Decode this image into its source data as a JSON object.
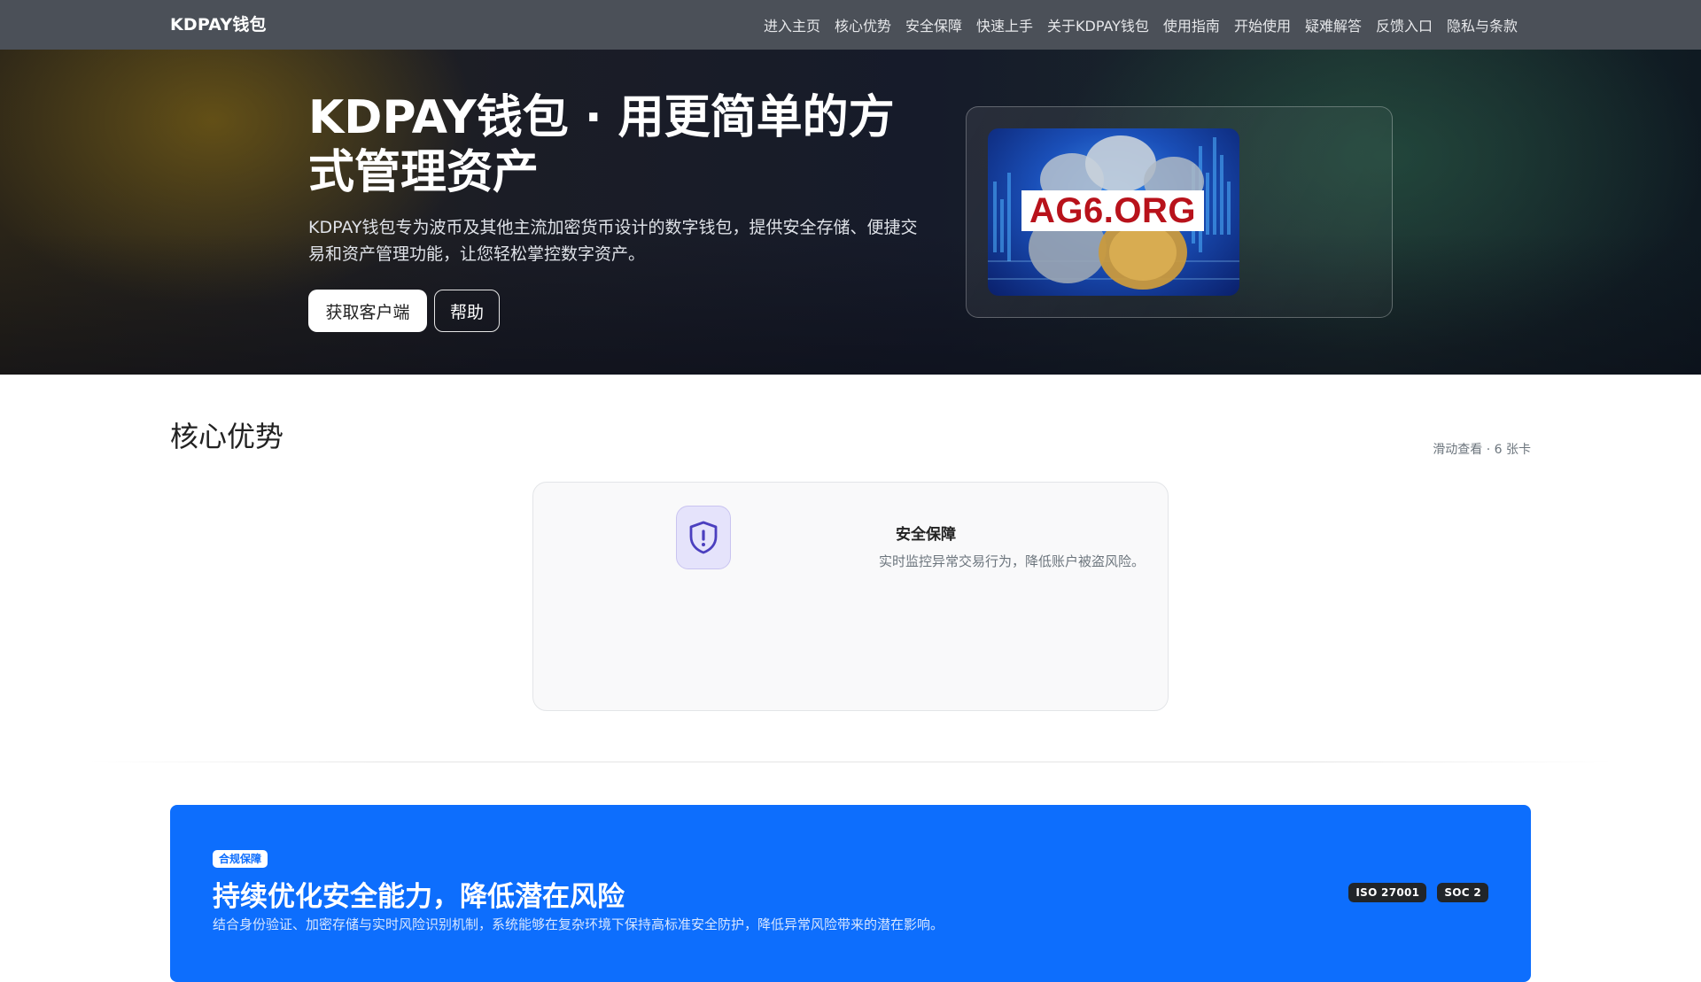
{
  "navbar": {
    "brand": "KDPAY钱包",
    "links": [
      "进入主页",
      "核心优势",
      "安全保障",
      "快速上手",
      "关于KDPAY钱包",
      "使用指南",
      "开始使用",
      "疑难解答",
      "反馈入口",
      "隐私与条款"
    ]
  },
  "hero": {
    "title": "KDPAY钱包 · 用更简单的方式管理资产",
    "description": "KDPAY钱包专为波币及其他主流加密货币设计的数字钱包，提供安全存储、便捷交易和资产管理功能，让您轻松掌控数字资产。",
    "primary_button": "获取客户端",
    "secondary_button": "帮助",
    "image_logo_text": "AG6.ORG"
  },
  "core": {
    "title": "核心优势",
    "hint": "滑动查看 · 6 张卡",
    "card": {
      "icon": "shield-alert-icon",
      "title": "安全保障",
      "description": "实时监控异常交易行为，降低账户被盗风险。"
    }
  },
  "banner": {
    "badge": "合规保障",
    "title": "持续优化安全能力，降低潜在风险",
    "description": "结合身份验证、加密存储与实时风险识别机制，系统能够在复杂环境下保持高标准安全防护，降低异常风险带来的潜在影响。",
    "certs": [
      "ISO 27001",
      "SOC 2"
    ]
  },
  "colors": {
    "navbar": "#4b5058",
    "banner": "#0d6efd",
    "icon_accent": "#4b3fbf"
  }
}
